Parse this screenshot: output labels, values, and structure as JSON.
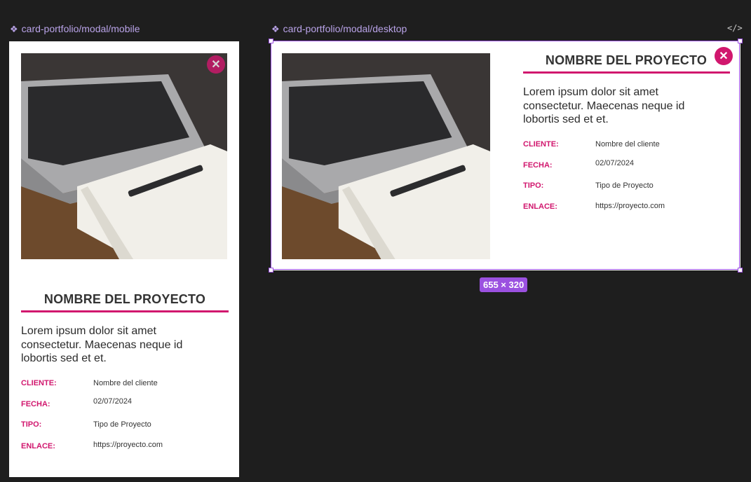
{
  "frames": {
    "mobile_label": "card-portfolio/modal/mobile",
    "desktop_label": "card-portfolio/modal/desktop",
    "component_icon": "component-icon",
    "code_icon": "</>",
    "size_badge": "655 × 320"
  },
  "card": {
    "title": "NOMBRE DEL PROYECTO",
    "description": "Lorem ipsum dolor sit amet consectetur. Maecenas neque id lobortis sed et et.",
    "close_icon": "close-icon",
    "fields": [
      {
        "label": "CLIENTE:",
        "value": "Nombre del cliente"
      },
      {
        "label": "FECHA:",
        "value": "02/07/2024"
      },
      {
        "label": "TIPO:",
        "value": "Tipo de Proyecto"
      },
      {
        "label": "ENLACE:",
        "value": "https://proyecto.com"
      }
    ]
  },
  "colors": {
    "accent": "#d1176e",
    "selection": "#9b51e0",
    "canvas": "#1e1e1e"
  }
}
